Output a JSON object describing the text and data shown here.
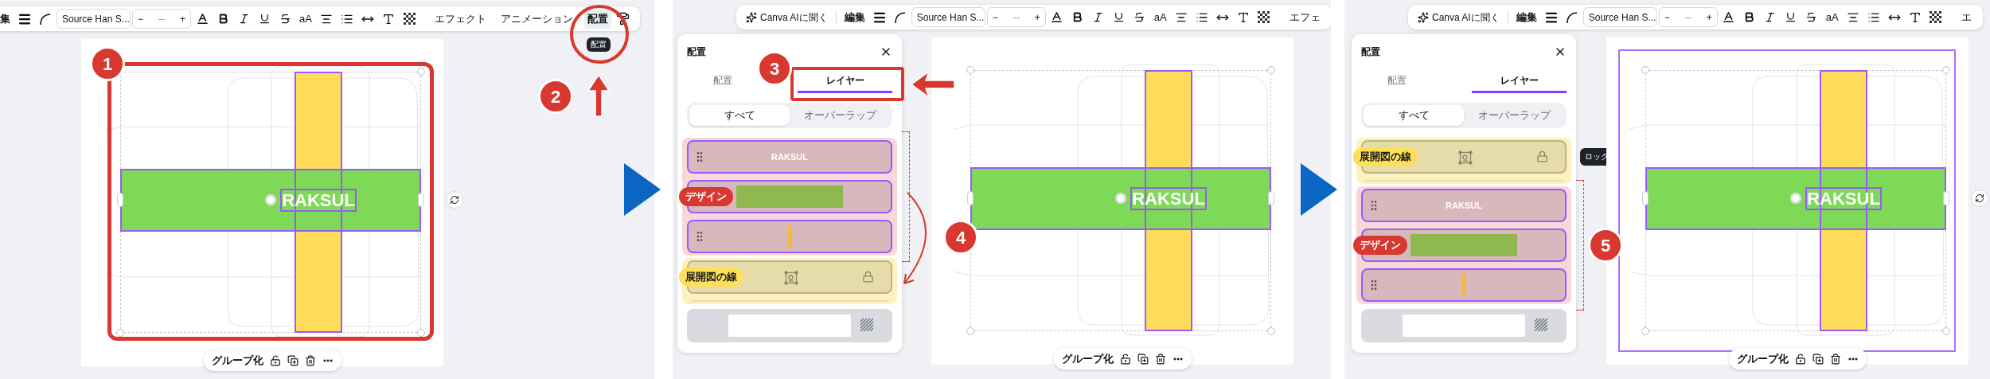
{
  "panels": [
    {
      "toolbar": {
        "edit_label": "集",
        "font": "Source Han S...",
        "size_minus": "−",
        "size_value": "--",
        "size_plus": "+",
        "case_label": "aA",
        "menus": [
          {
            "label": "エフェクト",
            "selected": false
          },
          {
            "label": "アニメーション",
            "selected": false
          },
          {
            "label": "配置",
            "selected": true
          }
        ],
        "tooltip": "配置"
      },
      "canvas": {
        "logo_text": "RAKSUL",
        "group_label": "グループ化",
        "highlighted": false
      },
      "callouts": [
        {
          "number": "1"
        },
        {
          "number": "2"
        }
      ]
    },
    {
      "toolbar": {
        "ai_label": "Canva AIに聞く",
        "edit_label": "編集",
        "font": "Source Han S...",
        "size_minus": "−",
        "size_value": "--",
        "size_plus": "+",
        "case_label": "aA",
        "menus": [
          {
            "label": "エフェ",
            "selected": false
          }
        ]
      },
      "layers_panel": {
        "title": "配置",
        "tabs": [
          {
            "label": "配置",
            "selected": false
          },
          {
            "label": "レイヤー",
            "selected": true
          }
        ],
        "filters": [
          {
            "label": "すべて",
            "selected": true
          },
          {
            "label": "オーバーラップ",
            "selected": false
          }
        ],
        "groups": [
          {
            "kind": "design",
            "tag": "デザイン",
            "layers": [
              {
                "kind": "text",
                "text": "RAKSUL"
              },
              {
                "kind": "hbar",
                "color": "#8fb950"
              },
              {
                "kind": "vbar",
                "color": "#f5b942"
              }
            ]
          },
          {
            "kind": "dieline",
            "tag": "展開図の線",
            "layers": [
              {
                "kind": "frame",
                "locked": true
              }
            ]
          },
          {
            "kind": "plain",
            "layers": [
              {
                "kind": "background"
              }
            ]
          }
        ]
      },
      "canvas": {
        "logo_text": "RAKSUL",
        "group_label": "グループ化",
        "highlighted": false
      },
      "callouts": [
        {
          "number": "3"
        },
        {
          "number": "4"
        }
      ]
    },
    {
      "toolbar": {
        "ai_label": "Canva AIに聞く",
        "edit_label": "編集",
        "font": "Source Han S...",
        "size_minus": "−",
        "size_value": "--",
        "size_plus": "+",
        "case_label": "aA",
        "menus": [
          {
            "label": "エ",
            "selected": false
          }
        ]
      },
      "layers_panel": {
        "title": "配置",
        "tabs": [
          {
            "label": "配置",
            "selected": false
          },
          {
            "label": "レイヤー",
            "selected": true
          }
        ],
        "filters": [
          {
            "label": "すべて",
            "selected": true
          },
          {
            "label": "オーバーラップ",
            "selected": false
          }
        ],
        "lock_tooltip": "ロック",
        "groups": [
          {
            "kind": "dieline",
            "tag": "展開図の線",
            "layers": [
              {
                "kind": "frame",
                "locked": true
              }
            ]
          },
          {
            "kind": "design",
            "tag": "デザイン",
            "layers": [
              {
                "kind": "text",
                "text": "RAKSUL"
              },
              {
                "kind": "hbar",
                "color": "#8fb950"
              },
              {
                "kind": "vbar",
                "color": "#f5b942"
              }
            ]
          },
          {
            "kind": "plain",
            "layers": [
              {
                "kind": "background"
              }
            ]
          }
        ]
      },
      "canvas": {
        "logo_text": "RAKSUL",
        "group_label": "グループ化",
        "highlighted": true
      },
      "callouts": [
        {
          "number": "5"
        }
      ]
    }
  ]
}
